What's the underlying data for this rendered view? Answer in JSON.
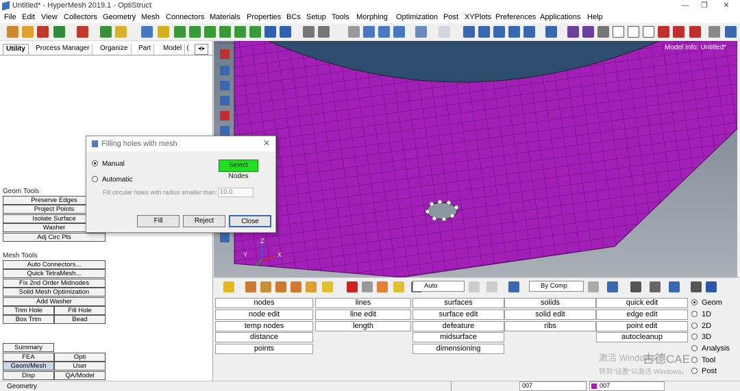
{
  "window": {
    "title": "Untitled* - HyperMesh 2019.1 - OptiStruct",
    "controls": [
      "—",
      "❐",
      "✕"
    ]
  },
  "menubar": [
    "File",
    "Edit",
    "View",
    "Collectors",
    "Geometry",
    "Mesh",
    "Connectors",
    "Materials",
    "Properties",
    "BCs",
    "Setup",
    "Tools",
    "Morphing",
    "Optimization",
    "Post",
    "XYPlots",
    "Preferences",
    "Applications",
    "Help"
  ],
  "left_tabs": [
    "Utility",
    "Process Manager",
    "Organize",
    "Part",
    "Model",
    "⟨",
    "◂|▸"
  ],
  "geom_tools": {
    "label": "Geom Tools",
    "buttons": [
      "Preserve Edges",
      "Project Points",
      "Isolate Surface",
      "Washer",
      "Adj Circ Pts"
    ]
  },
  "mesh_tools": {
    "label": "Mesh Tools",
    "buttons": [
      "Auto Connectors...",
      "Quick TetraMesh...",
      "Fix 2nd Order Midnodes",
      "Solid Mesh Optimization",
      "Add Washer"
    ],
    "pairs": [
      [
        "Trim Hole",
        "Fill Hole"
      ],
      [
        "Box Trim",
        "Bead"
      ]
    ]
  },
  "bottom_buttons": {
    "summary": "Summary",
    "grid": [
      [
        "FEA",
        "Opti"
      ],
      [
        "Geom/Mesh",
        "User"
      ],
      [
        "Disp",
        "QA/Model"
      ]
    ]
  },
  "viewport": {
    "model_info": "Model Info: Untitled*",
    "axes": {
      "x": "X",
      "y": "Y",
      "z": "Z"
    }
  },
  "dialog": {
    "title": "Filling holes with mesh",
    "close": "✕",
    "manual_label": "Manual",
    "select_nodes_label": "Select Nodes",
    "automatic_label": "Automatic",
    "radius_label": "Fill circular holes with radius smaller than:",
    "radius_value": "10.0",
    "fill_label": "Fill",
    "reject_label": "Reject",
    "close_label": "Close"
  },
  "vstrip": {
    "auto_label": "Auto",
    "bycomp_label": "By Comp"
  },
  "panels": {
    "col1": [
      "nodes",
      "node edit",
      "temp nodes",
      "distance",
      "points"
    ],
    "col2": [
      "lines",
      "line edit",
      "length"
    ],
    "col3": [
      "surfaces",
      "surface edit",
      "defeature",
      "midsurface",
      "dimensioning"
    ],
    "col4": [
      "solids",
      "solid edit",
      "ribs"
    ],
    "col5": [
      "quick edit",
      "edge edit",
      "point edit",
      "autocleanup"
    ]
  },
  "page_modes": [
    "Geom",
    "1D",
    "2D",
    "3D",
    "Analysis",
    "Tool",
    "Post"
  ],
  "status": {
    "left": "Geometry",
    "mid1": "007",
    "mid2": "007"
  },
  "watermark": [
    "激活 Windows",
    "转到\"设置\"以激活 Windows。",
    "古德CAE"
  ],
  "colors": {
    "mesh": "#a020b8",
    "mesh_line": "#5a0a66",
    "hole_surface": "#2e4d6e",
    "select_nodes_btn": "#22dd22",
    "background_gradient_bottom": "#9ca3aa"
  }
}
